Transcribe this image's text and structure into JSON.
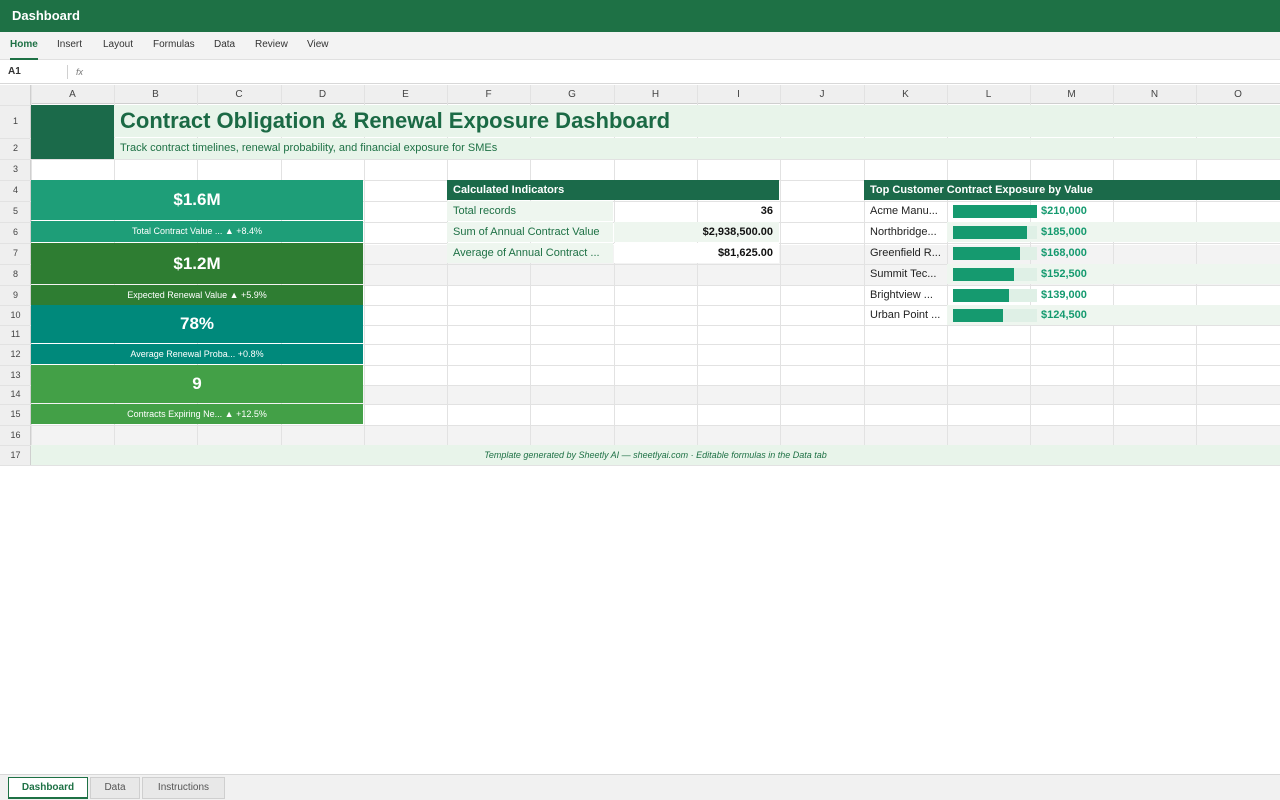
{
  "app": {
    "title": "Dashboard"
  },
  "ribbon": {
    "tabs": [
      "Home",
      "Insert",
      "Layout",
      "Formulas",
      "Data",
      "Review",
      "View"
    ],
    "active": "Home"
  },
  "formula_bar": {
    "cell_ref": "A1",
    "fx_label": "fx",
    "value": ""
  },
  "grid": {
    "columns": [
      "A",
      "B",
      "C",
      "D",
      "E",
      "F",
      "G",
      "H",
      "I",
      "J",
      "K",
      "L",
      "M",
      "N",
      "O"
    ],
    "rows": [
      "1",
      "2",
      "3",
      "4",
      "5",
      "6",
      "7",
      "8",
      "9",
      "10",
      "11",
      "12",
      "13",
      "14",
      "15",
      "16",
      "17"
    ]
  },
  "dashboard": {
    "title": "Contract Obligation & Renewal Exposure Dashboard",
    "subtitle": "Track contract timelines, renewal probability, and financial exposure for SMEs"
  },
  "kpis": [
    {
      "value": "$1.6M",
      "label": "Total Contract Value ... ▲ +8.4%",
      "color": "#1e9e78"
    },
    {
      "value": "$1.2M",
      "label": "Expected Renewal Value ▲ +5.9%",
      "color": "#2e7d32"
    },
    {
      "value": "78%",
      "label": "Average Renewal Proba... +0.8%",
      "color": "#00897b"
    },
    {
      "value": "9",
      "label": "Contracts Expiring Ne... ▲ +12.5%",
      "color": "#43a047"
    }
  ],
  "indicators": {
    "header": "Calculated Indicators",
    "rows": [
      {
        "label": "Total records",
        "value": "36"
      },
      {
        "label": "Sum of Annual Contract Value",
        "value": "$2,938,500.00"
      },
      {
        "label": "Average of Annual Contract ...",
        "value": "$81,625.00"
      }
    ]
  },
  "exposure": {
    "header": "Top Customer Contract Exposure by Value",
    "rows": [
      {
        "name": "Acme Manu...",
        "value": "$210,000",
        "fraction": 1.0
      },
      {
        "name": "Northbridge...",
        "value": "$185,000",
        "fraction": 0.881
      },
      {
        "name": "Greenfield R...",
        "value": "$168,000",
        "fraction": 0.8
      },
      {
        "name": "Summit Tec...",
        "value": "$152,500",
        "fraction": 0.726
      },
      {
        "name": "Brightview ...",
        "value": "$139,000",
        "fraction": 0.662
      },
      {
        "name": "Urban Point ...",
        "value": "$124,500",
        "fraction": 0.593
      }
    ]
  },
  "footer": {
    "text": "Template generated by Sheetly AI — sheetlyai.com · Editable formulas in the Data tab"
  },
  "sheets": {
    "tabs": [
      "Dashboard",
      "Data",
      "Instructions"
    ],
    "active": "Dashboard"
  }
}
